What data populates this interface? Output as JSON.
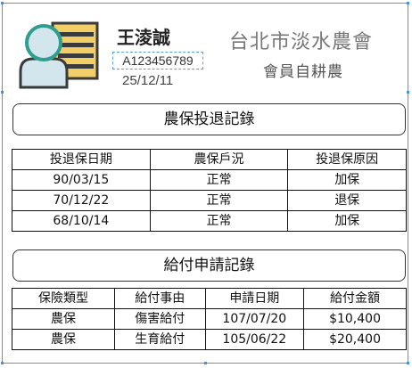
{
  "member": {
    "name": "王淩誠",
    "id_number": "A123456789",
    "date": "25/12/11",
    "organization": "台北市淡水農會",
    "member_type": "會員自耕農"
  },
  "enrollment": {
    "title": "農保投退記錄",
    "headers": [
      "投退保日期",
      "農保戶況",
      "投退保原因"
    ],
    "rows": [
      [
        "90/03/15",
        "正常",
        "加保"
      ],
      [
        "70/12/22",
        "正常",
        "退保"
      ],
      [
        "68/10/14",
        "正常",
        "加保"
      ]
    ]
  },
  "claims": {
    "title": "給付申請記錄",
    "headers": [
      "保險類型",
      "給付事由",
      "申請日期",
      "給付金額"
    ],
    "rows": [
      [
        "農保",
        "傷害給付",
        "107/07/20",
        "$10,400"
      ],
      [
        "農保",
        "生育給付",
        "105/06/22",
        "$20,400"
      ]
    ]
  },
  "colors": {
    "avatar_teal": "#2f9e8f",
    "avatar_fill": "#d3e6ee",
    "avatar_dark": "#3a3a3a",
    "avatar_yellow": "#f1cf66",
    "selection_blue": "#4a90d9"
  },
  "icons": {
    "avatar": "person-with-document-icon"
  }
}
